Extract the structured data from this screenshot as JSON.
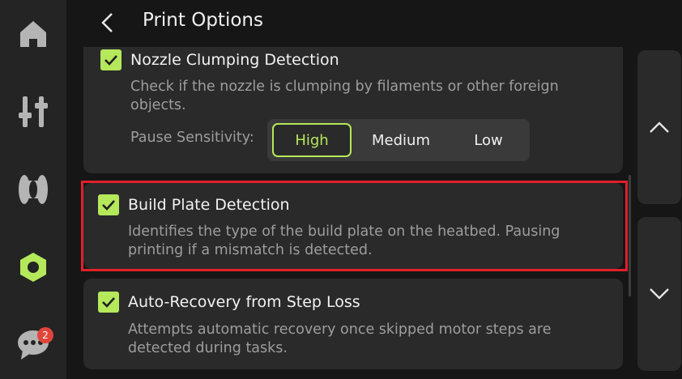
{
  "header": {
    "title": "Print Options"
  },
  "sidebar": {
    "items": [
      {
        "icon": "home-icon"
      },
      {
        "icon": "sliders-icon"
      },
      {
        "icon": "filament-icon"
      },
      {
        "icon": "settings-hex-icon",
        "active": true
      },
      {
        "icon": "chat-icon",
        "badge": "2"
      }
    ]
  },
  "options": [
    {
      "title": "Nozzle Clumping Detection",
      "description": "Check if the nozzle is clumping by filaments or other foreign objects.",
      "checked": true,
      "sensitivity": {
        "label": "Pause Sensitivity:",
        "options": [
          "High",
          "Medium",
          "Low"
        ],
        "selected": "High"
      }
    },
    {
      "title": "Build Plate Detection",
      "description": "Identifies the type of the build plate on the heatbed. Pausing printing if a mismatch is detected.",
      "checked": true
    },
    {
      "title": "Auto-Recovery from Step Loss",
      "description": "Attempts automatic recovery once skipped motor steps are detected during tasks.",
      "checked": true
    }
  ],
  "colors": {
    "accent": "#b5e85b",
    "highlight": "#e0202a",
    "badge": "#e0453a"
  }
}
